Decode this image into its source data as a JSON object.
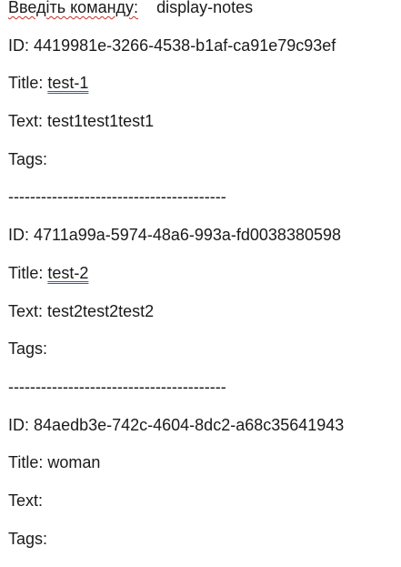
{
  "command_line": {
    "label": "Введіть команду:",
    "command": "display-notes"
  },
  "notes": [
    {
      "id_label": "ID:",
      "id": "4419981e-3266-4538-b1af-ca91e79c93ef",
      "title_label": "Title:",
      "title": "test-1",
      "text_label": "Text:",
      "text": "test1test1test1",
      "tags_label": "Tags:",
      "tags": ""
    },
    {
      "id_label": "ID:",
      "id": "4711a99a-5974-48a6-993a-fd0038380598",
      "title_label": "Title:",
      "title": "test-2",
      "text_label": "Text:",
      "text": "test2test2test2",
      "tags_label": "Tags:",
      "tags": ""
    },
    {
      "id_label": "ID:",
      "id": "84aedb3e-742c-4604-8dc2-a68c35641943",
      "title_label": "Title:",
      "title": "woman",
      "text_label": "Text:",
      "text": "",
      "tags_label": "Tags:",
      "tags": ""
    }
  ],
  "separator": "----------------------------------------"
}
